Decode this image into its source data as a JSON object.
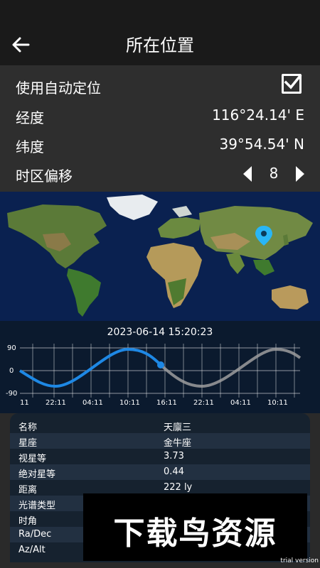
{
  "header": {
    "title": "所在位置"
  },
  "settings": {
    "auto_location": {
      "label": "使用自动定位",
      "checked": true
    },
    "longitude": {
      "label": "经度",
      "value": "116°24.14' E"
    },
    "latitude": {
      "label": "纬度",
      "value": "39°54.54' N"
    },
    "timezone": {
      "label": "时区偏移",
      "value": "8"
    }
  },
  "timeline": {
    "datetime": "2023-06-14 15:20:23",
    "y_ticks": [
      "90",
      "0",
      "-90"
    ],
    "x_ticks": [
      "11",
      "22:11",
      "04:11",
      "10:11",
      "16:11",
      "22:11",
      "04:11",
      "10:11"
    ]
  },
  "info": {
    "rows": [
      {
        "k": "名称",
        "v": "天廪三"
      },
      {
        "k": "星座",
        "v": "金牛座"
      },
      {
        "k": "视星等",
        "v": "3.73"
      },
      {
        "k": "绝对星等",
        "v": "0.44"
      },
      {
        "k": "距离",
        "v": "222  ly"
      },
      {
        "k": "光谱类型",
        "v": ""
      },
      {
        "k": "时角",
        "v": ""
      },
      {
        "k": "Ra/Dec",
        "v": ""
      },
      {
        "k": "Az/Alt",
        "v": ""
      }
    ]
  },
  "watermark": {
    "text": "下载鸟资源",
    "trial": "trial version"
  },
  "colors": {
    "accent_blue": "#1e88e5",
    "marker": "#29b6f6"
  }
}
